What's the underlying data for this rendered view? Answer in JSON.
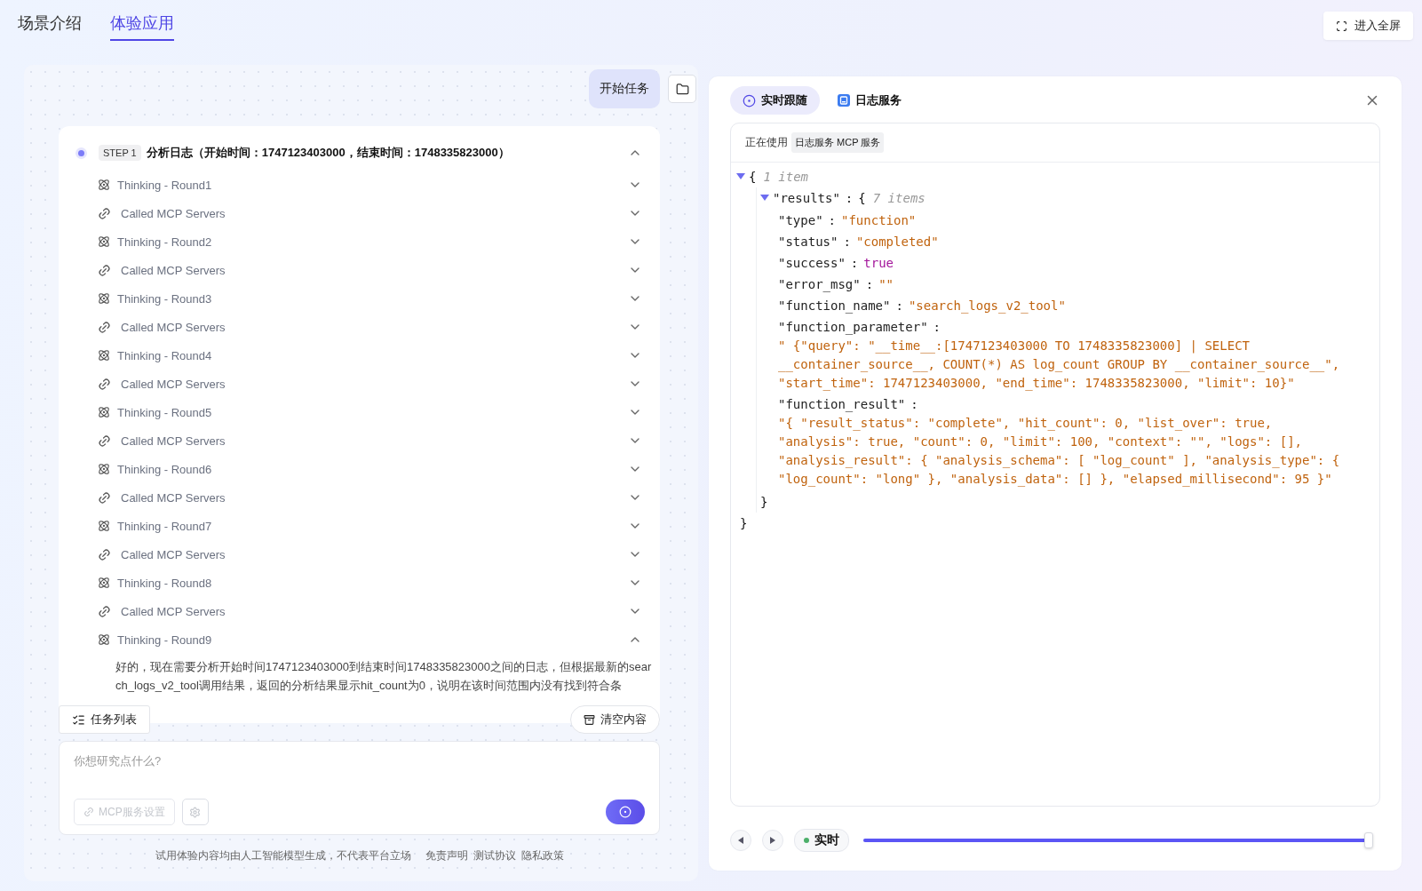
{
  "top_tabs": [
    {
      "label": "场景介绍",
      "selected": false
    },
    {
      "label": "体验应用",
      "selected": true
    }
  ],
  "fullscreen_button": "进入全屏",
  "user_message": "开始任务",
  "step": {
    "badge": "STEP 1",
    "title": "分析日志（开始时间：1747123403000，结束时间：1748335823000）",
    "expanded": true,
    "items": [
      {
        "kind": "thinking",
        "label": "Thinking - Round1",
        "expanded": false
      },
      {
        "kind": "mcp",
        "label": "Called MCP Servers",
        "expanded": false
      },
      {
        "kind": "thinking",
        "label": "Thinking - Round2",
        "expanded": false
      },
      {
        "kind": "mcp",
        "label": "Called MCP Servers",
        "expanded": false
      },
      {
        "kind": "thinking",
        "label": "Thinking - Round3",
        "expanded": false
      },
      {
        "kind": "mcp",
        "label": "Called MCP Servers",
        "expanded": false
      },
      {
        "kind": "thinking",
        "label": "Thinking - Round4",
        "expanded": false
      },
      {
        "kind": "mcp",
        "label": "Called MCP Servers",
        "expanded": false
      },
      {
        "kind": "thinking",
        "label": "Thinking - Round5",
        "expanded": false
      },
      {
        "kind": "mcp",
        "label": "Called MCP Servers",
        "expanded": false
      },
      {
        "kind": "thinking",
        "label": "Thinking - Round6",
        "expanded": false
      },
      {
        "kind": "mcp",
        "label": "Called MCP Servers",
        "expanded": false
      },
      {
        "kind": "thinking",
        "label": "Thinking - Round7",
        "expanded": false
      },
      {
        "kind": "mcp",
        "label": "Called MCP Servers",
        "expanded": false
      },
      {
        "kind": "thinking",
        "label": "Thinking - Round8",
        "expanded": false
      },
      {
        "kind": "mcp",
        "label": "Called MCP Servers",
        "expanded": false
      },
      {
        "kind": "thinking",
        "label": "Thinking - Round9",
        "expanded": true,
        "text": "好的，现在需要分析开始时间1747123403000到结束时间1748335823000之间的日志，但根据最新的search_logs_v2_tool调用结果，返回的分析结果显示hit_count为0，说明在该时间范围内没有找到符合条"
      }
    ]
  },
  "task_list_button": "任务列表",
  "clear_button": "清空内容",
  "input": {
    "placeholder": "你想研究点什么?"
  },
  "mcp_settings_button": "MCP服务设置",
  "footer": {
    "notice": "试用体验内容均由人工智能模型生成，不代表平台立场",
    "links": [
      "免责声明",
      "测试协议",
      "隐私政策"
    ]
  },
  "panel_tabs": [
    {
      "kind": "live",
      "label": "实时跟随",
      "selected": true
    },
    {
      "kind": "log",
      "label": "日志服务",
      "selected": false
    }
  ],
  "using_label": "正在使用",
  "using_tag": "日志服务 MCP 服务",
  "json_view": {
    "open_brace": "{",
    "root_count": "1 item",
    "expanded": true,
    "results": {
      "key": "\"results\"",
      "separator": ":",
      "open_brace": "{",
      "count": "7 items",
      "expanded": true,
      "entries": [
        {
          "key": "\"type\"",
          "separator": ":",
          "value": "\"function\"",
          "kind": "string"
        },
        {
          "key": "\"status\"",
          "separator": ":",
          "value": "\"completed\"",
          "kind": "string"
        },
        {
          "key": "\"success\"",
          "separator": ":",
          "value": "true",
          "kind": "boolean"
        },
        {
          "key": "\"error_msg\"",
          "separator": ":",
          "value": "\"\"",
          "kind": "string"
        },
        {
          "key": "\"function_name\"",
          "separator": ":",
          "value": "\"search_logs_v2_tool\"",
          "kind": "string"
        },
        {
          "key": "\"function_parameter\"",
          "separator": ":",
          "value": "\" {\"query\": \"__time__:[1747123403000 TO 1748335823000] | SELECT __container_source__, COUNT(*) AS log_count GROUP BY __container_source__\", \"start_time\": 1747123403000, \"end_time\": 1748335823000, \"limit\": 10}\"",
          "kind": "long"
        },
        {
          "key": "\"function_result\"",
          "separator": ":",
          "value": "\"{ \"result_status\": \"complete\", \"hit_count\": 0, \"list_over\": true, \"analysis\": true, \"count\": 0, \"limit\": 100, \"context\": \"\", \"logs\": [], \"analysis_result\": { \"analysis_schema\": [ \"log_count\" ], \"analysis_type\": { \"log_count\": \"long\" }, \"analysis_data\": [] }, \"elapsed_millisecond\": 95 }\"",
          "kind": "long"
        }
      ],
      "close_brace": "}"
    },
    "close_brace": "}"
  },
  "playback": {
    "live_label": "实时",
    "live": true,
    "level": 1.0
  }
}
